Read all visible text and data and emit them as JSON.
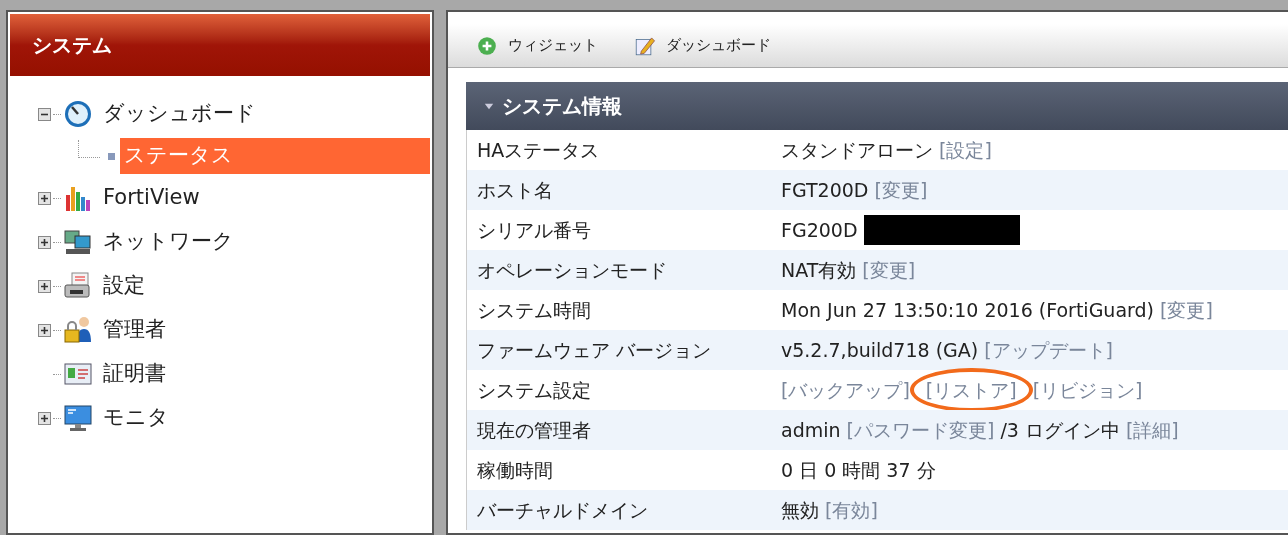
{
  "sidebar": {
    "title": "システム",
    "items": [
      {
        "label": "ダッシュボード",
        "expanded": true,
        "selected": false,
        "children": [
          {
            "label": "ステータス",
            "selected": true
          }
        ]
      },
      {
        "label": "FortiView",
        "expanded": false,
        "selected": false
      },
      {
        "label": "ネットワーク",
        "expanded": false,
        "selected": false
      },
      {
        "label": "設定",
        "expanded": false,
        "selected": false
      },
      {
        "label": "管理者",
        "expanded": false,
        "selected": false
      },
      {
        "label": "証明書",
        "selected": false
      },
      {
        "label": "モニタ",
        "expanded": false,
        "selected": false
      }
    ]
  },
  "toolbar": [
    {
      "label": "ウィジェット"
    },
    {
      "label": "ダッシュボード"
    }
  ],
  "widget": {
    "title": "システム情報",
    "expanded": true,
    "rows": [
      {
        "label": "HAステータス",
        "value": [
          {
            "kind": "text",
            "text": "スタンドアローン"
          },
          {
            "kind": "link",
            "text": "[設定]"
          }
        ]
      },
      {
        "label": "ホスト名",
        "value": [
          {
            "kind": "text",
            "text": "FGT200D"
          },
          {
            "kind": "link",
            "text": "[変更]"
          }
        ]
      },
      {
        "label": "シリアル番号",
        "value": [
          {
            "kind": "text",
            "text": "FG200D"
          },
          {
            "kind": "redaction"
          }
        ]
      },
      {
        "label": "オペレーションモード",
        "value": [
          {
            "kind": "text",
            "text": "NAT有効"
          },
          {
            "kind": "link",
            "text": "[変更]"
          }
        ]
      },
      {
        "label": "システム時間",
        "value": [
          {
            "kind": "text",
            "text": "Mon Jun 27 13:50:10 2016 (FortiGuard)"
          },
          {
            "kind": "link",
            "text": "[変更]"
          }
        ]
      },
      {
        "label": "ファームウェア バージョン",
        "value": [
          {
            "kind": "text",
            "text": "v5.2.7,build718 (GA)"
          },
          {
            "kind": "link",
            "text": "[アップデート]"
          }
        ]
      },
      {
        "label": "システム設定",
        "value": [
          {
            "kind": "link",
            "text": "[バックアップ]"
          },
          {
            "kind": "link",
            "text": "[リストア]",
            "circled": true
          },
          {
            "kind": "link",
            "text": "[リビジョン]"
          }
        ]
      },
      {
        "label": "現在の管理者",
        "value": [
          {
            "kind": "text",
            "text": "admin"
          },
          {
            "kind": "link",
            "text": "[パスワード変更]"
          },
          {
            "kind": "text",
            "text": "/3 ログイン中"
          },
          {
            "kind": "link",
            "text": "[詳細]"
          }
        ]
      },
      {
        "label": "稼働時間",
        "value": [
          {
            "kind": "text",
            "text": "0 日 0 時間 37 分"
          }
        ]
      },
      {
        "label": "バーチャルドメイン",
        "value": [
          {
            "kind": "text",
            "text": "無効"
          },
          {
            "kind": "link",
            "text": "[有効]"
          }
        ]
      }
    ]
  }
}
